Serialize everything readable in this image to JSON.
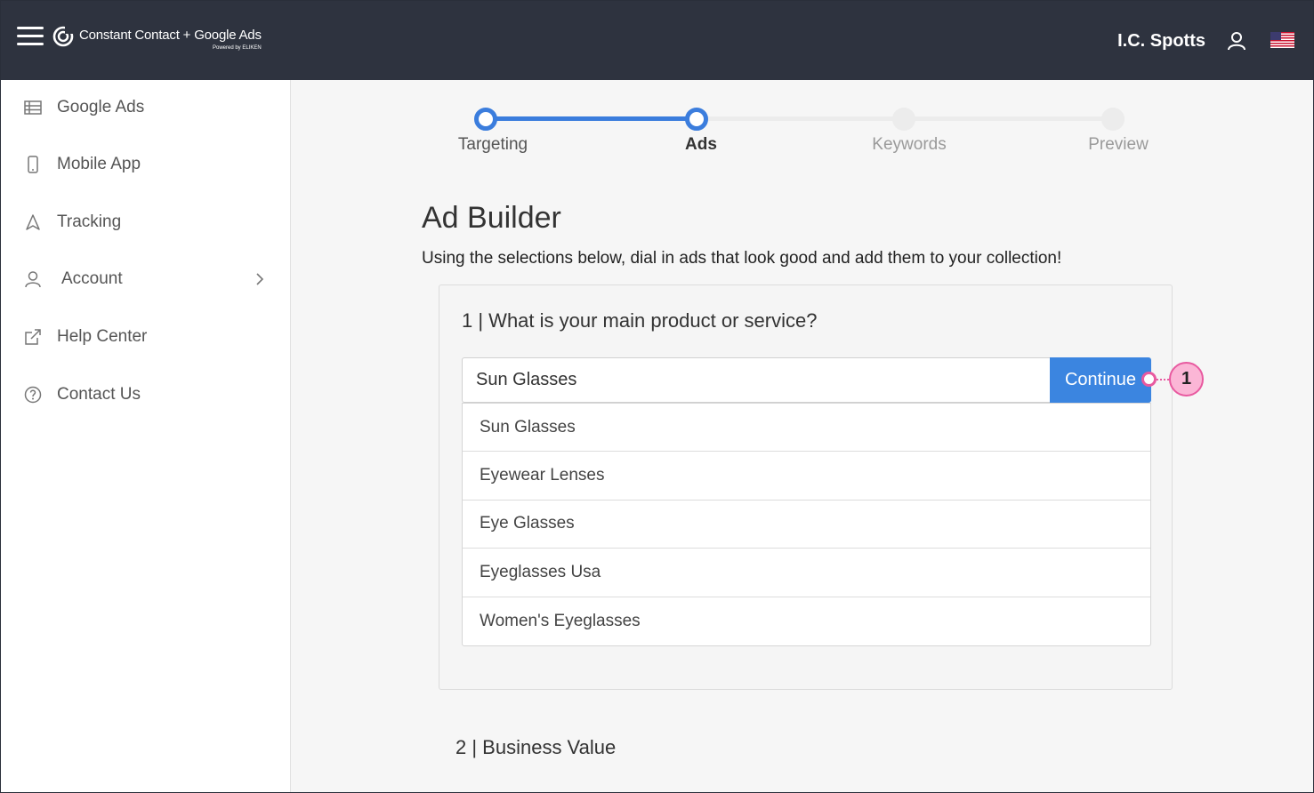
{
  "header": {
    "logo_text": "Constant Contact + Google Ads",
    "logo_subtext": "Powered by ELIKEN",
    "user_name": "I.C. Spotts"
  },
  "sidebar": {
    "items": [
      {
        "label": "Google Ads",
        "icon": "table-icon"
      },
      {
        "label": "Mobile App",
        "icon": "mobile-icon"
      },
      {
        "label": "Tracking",
        "icon": "navigation-icon"
      },
      {
        "label": "Account",
        "icon": "user-icon"
      },
      {
        "label": "Help Center",
        "icon": "external-link-icon"
      },
      {
        "label": "Contact Us",
        "icon": "question-circle-icon"
      }
    ]
  },
  "stepper": {
    "steps": [
      {
        "label": "Targeting",
        "state": "complete"
      },
      {
        "label": "Ads",
        "state": "current"
      },
      {
        "label": "Keywords",
        "state": "upcoming"
      },
      {
        "label": "Preview",
        "state": "upcoming"
      }
    ]
  },
  "main": {
    "title": "Ad Builder",
    "subtitle": "Using the selections below, dial in ads that look good and add them to your collection!",
    "section1": {
      "title": "1 | What is your main product or service?",
      "input_value": "Sun Glasses",
      "button_label": "Continue",
      "suggestions": [
        "Sun Glasses",
        "Eyewear Lenses",
        "Eye Glasses",
        "Eyeglasses Usa",
        "Women's Eyeglasses"
      ]
    },
    "section2": {
      "title": "2 | Business Value"
    }
  },
  "callout": {
    "number": "1"
  },
  "colors": {
    "topbar": "#2e333f",
    "accent": "#3b85e0",
    "callout": "#e85aa0"
  }
}
